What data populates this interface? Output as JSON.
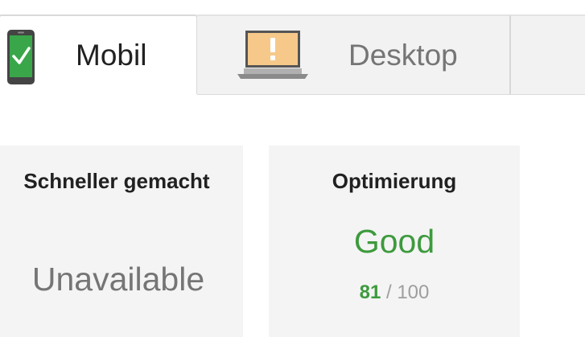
{
  "tabs": [
    {
      "label": "Mobil",
      "icon": "phone-check-icon",
      "selected": true
    },
    {
      "label": "Desktop",
      "icon": "laptop-warning-icon",
      "selected": false
    }
  ],
  "cards": {
    "speed": {
      "title": "Schneller gemacht",
      "status": "Unavailable"
    },
    "optimization": {
      "title": "Optimierung",
      "status": "Good",
      "score": "81",
      "score_separator": " / ",
      "score_max": "100"
    }
  },
  "colors": {
    "good": "#3d9a3d",
    "phone": "#3aa64a",
    "laptop_screen": "#f6c98a",
    "muted": "#757575"
  }
}
